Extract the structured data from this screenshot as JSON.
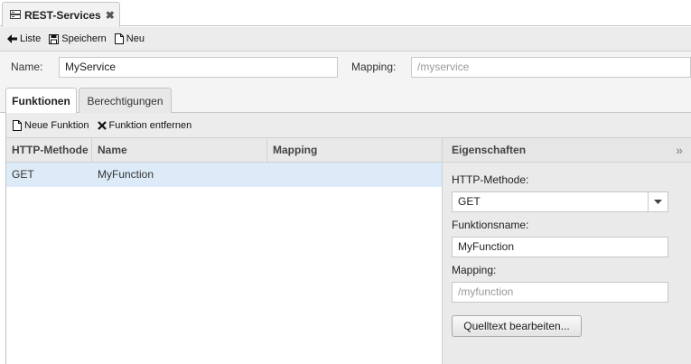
{
  "window": {
    "tab_title": "REST-Services"
  },
  "toolbar": {
    "list_label": "Liste",
    "save_label": "Speichern",
    "new_label": "Neu"
  },
  "form": {
    "name_label": "Name:",
    "name_value": "MyService",
    "mapping_label": "Mapping:",
    "mapping_placeholder": "/myservice"
  },
  "subtabs": [
    {
      "label": "Funktionen",
      "active": true
    },
    {
      "label": "Berechtigungen",
      "active": false
    }
  ],
  "functions_toolbar": {
    "new_function_label": "Neue Funktion",
    "remove_function_label": "Funktion entfernen"
  },
  "grid": {
    "columns": [
      "HTTP-Methode",
      "Name",
      "Mapping"
    ],
    "rows": [
      {
        "method": "GET",
        "name": "MyFunction",
        "mapping": ""
      }
    ]
  },
  "properties": {
    "title": "Eigenschaften",
    "collapse_glyph": "»",
    "http_method_label": "HTTP-Methode:",
    "http_method_value": "GET",
    "function_name_label": "Funktionsname:",
    "function_name_value": "MyFunction",
    "mapping_label": "Mapping:",
    "mapping_placeholder": "/myfunction",
    "edit_source_label": "Quelltext bearbeiten..."
  },
  "icons": {
    "tab": "server-list-icon",
    "close": "close-icon",
    "list": "arrow-left-icon",
    "save": "floppy-disk-icon",
    "new": "new-document-icon",
    "remove": "remove-x-icon",
    "dropdown": "chevron-down-icon"
  }
}
